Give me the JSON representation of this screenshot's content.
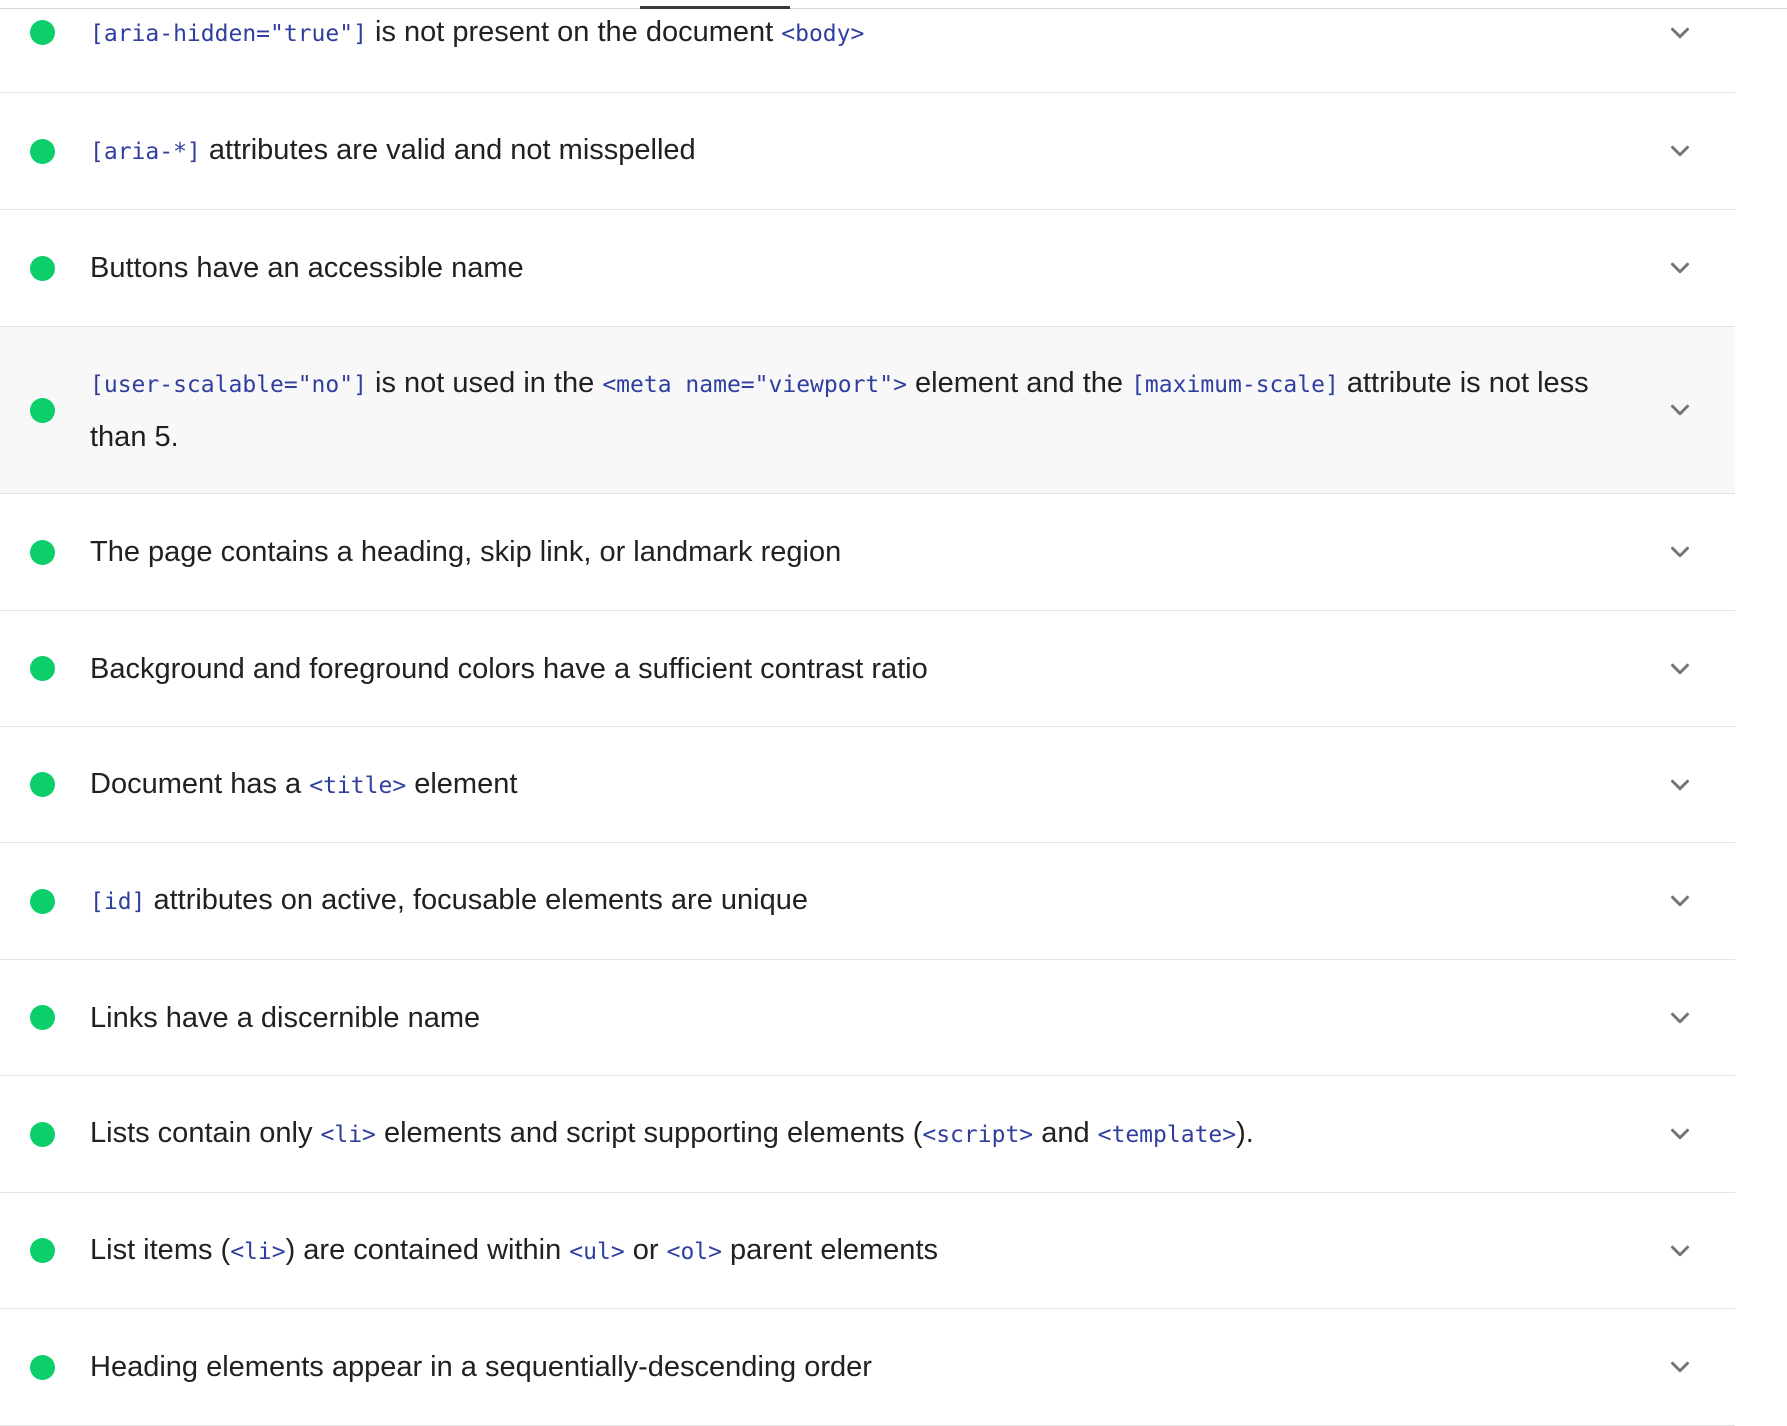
{
  "colors": {
    "pass": "#0cce6b",
    "code": "#303f9f",
    "text": "#212121",
    "divider": "#e3e3e3",
    "highlight_bg": "#f8f8f8"
  },
  "icons": {
    "status": "pass-dot-icon",
    "expand": "chevron-down-icon"
  },
  "audits": [
    {
      "parts": [
        {
          "code": "[aria-hidden=\"true\"]"
        },
        {
          "text": " is not present on the document "
        },
        {
          "code": "<body>"
        }
      ]
    },
    {
      "parts": [
        {
          "code": "[aria-*]"
        },
        {
          "text": " attributes are valid and not misspelled"
        }
      ]
    },
    {
      "parts": [
        {
          "text": "Buttons have an accessible name"
        }
      ]
    },
    {
      "parts": [
        {
          "code": "[user-scalable=\"no\"]"
        },
        {
          "text": " is not used in the "
        },
        {
          "code": "<meta name=\"viewport\">"
        },
        {
          "text": " element and the "
        },
        {
          "code": "[maximum-scale]"
        },
        {
          "text": " attribute is not less than 5."
        }
      ]
    },
    {
      "parts": [
        {
          "text": "The page contains a heading, skip link, or landmark region"
        }
      ]
    },
    {
      "parts": [
        {
          "text": "Background and foreground colors have a sufficient contrast ratio"
        }
      ]
    },
    {
      "parts": [
        {
          "text": "Document has a "
        },
        {
          "code": "<title>"
        },
        {
          "text": " element"
        }
      ]
    },
    {
      "parts": [
        {
          "code": "[id]"
        },
        {
          "text": " attributes on active, focusable elements are unique"
        }
      ]
    },
    {
      "parts": [
        {
          "text": "Links have a discernible name"
        }
      ]
    },
    {
      "parts": [
        {
          "text": "Lists contain only "
        },
        {
          "code": "<li>"
        },
        {
          "text": " elements and script supporting elements ("
        },
        {
          "code": "<script>"
        },
        {
          "text": " and "
        },
        {
          "code": "<template>"
        },
        {
          "text": ")."
        }
      ]
    },
    {
      "parts": [
        {
          "text": "List items ("
        },
        {
          "code": "<li>"
        },
        {
          "text": ") are contained within "
        },
        {
          "code": "<ul>"
        },
        {
          "text": " or "
        },
        {
          "code": "<ol>"
        },
        {
          "text": " parent elements"
        }
      ]
    },
    {
      "parts": [
        {
          "text": "Heading elements appear in a sequentially-descending order"
        }
      ]
    }
  ]
}
